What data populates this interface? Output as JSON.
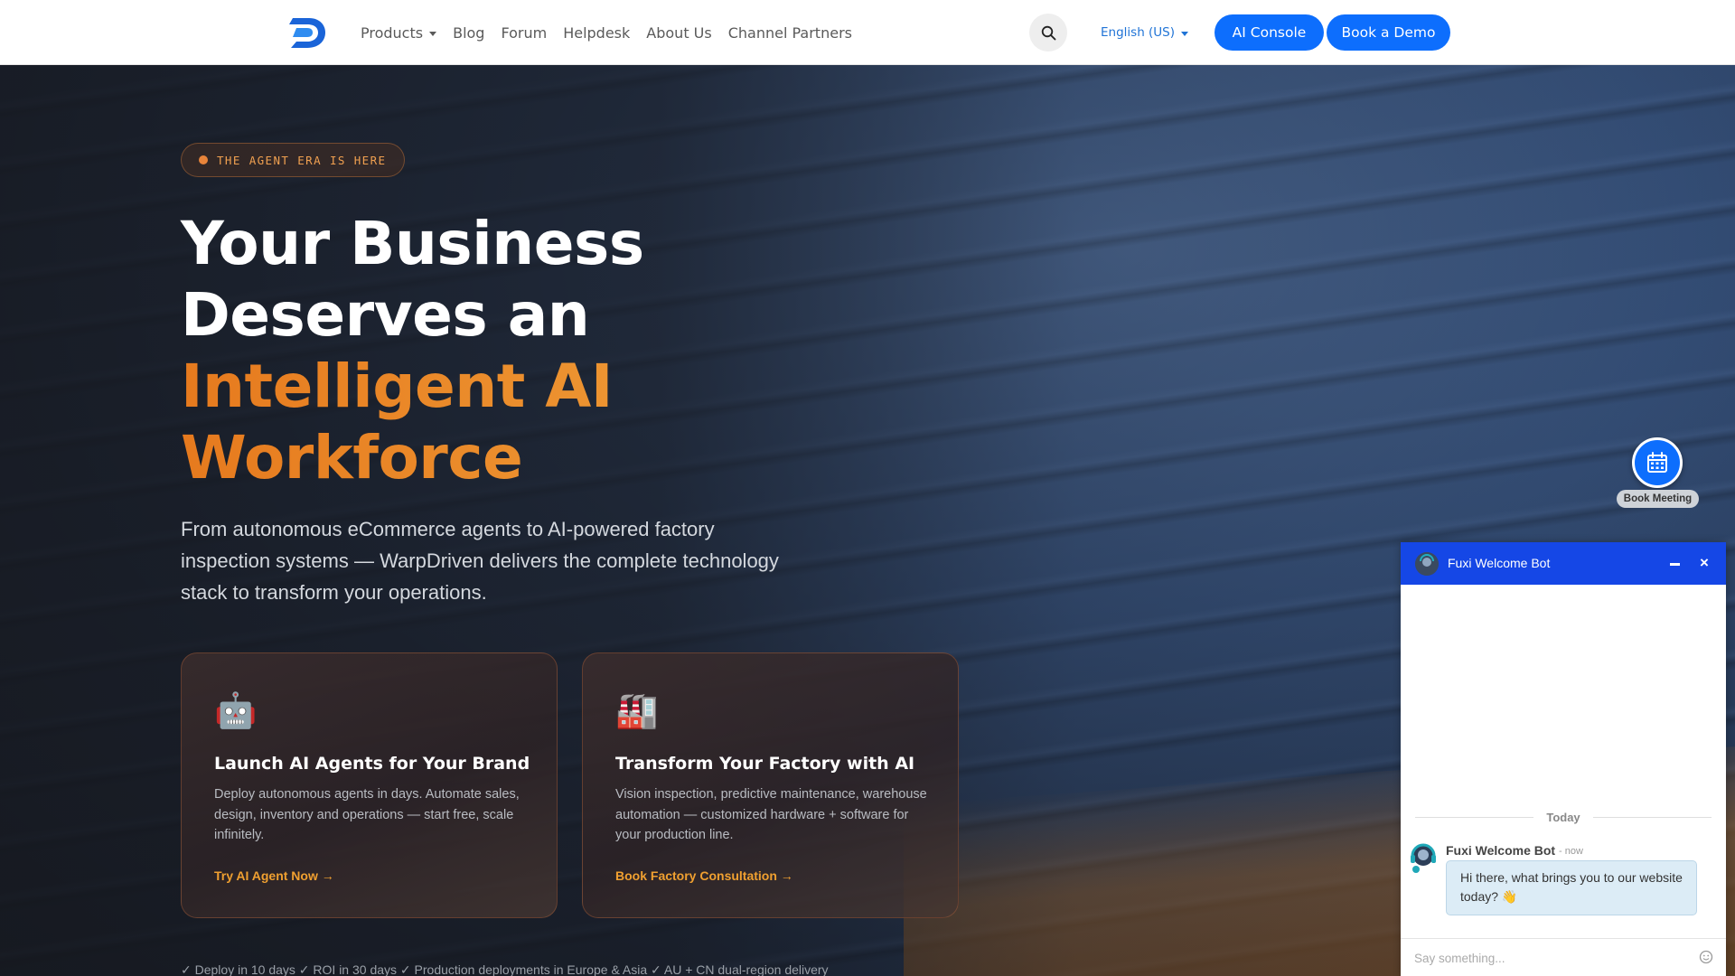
{
  "nav": {
    "links": [
      "Products",
      "Blog",
      "Forum",
      "Helpdesk",
      "About Us",
      "Channel Partners"
    ],
    "language": "English (US)",
    "console_label": "AI Console",
    "demo_label": "Book a Demo"
  },
  "hero": {
    "badge": "THE AGENT ERA IS HERE",
    "headline_white_1": "Your Business",
    "headline_white_2": "Deserves an",
    "headline_orange_1": "Intelligent AI",
    "headline_orange_2": "Workforce",
    "subtitle": "From autonomous eCommerce agents to AI-powered factory inspection systems — WarpDriven delivers the complete technology stack to transform your operations.",
    "cards": [
      {
        "icon": "🤖",
        "title": "Launch AI Agents for Your Brand",
        "description": "Deploy autonomous agents in days. Automate sales, design, inventory and operations — start free, scale infinitely.",
        "link": "Try AI Agent Now →"
      },
      {
        "icon": "🏭",
        "title": "Transform Your Factory with AI",
        "description": "Vision inspection, predictive maintenance, warehouse automation — customized hardware + software for your production line.",
        "link": "Book Factory Consultation →"
      }
    ],
    "trust_line": "✓ Deploy in 10 days ✓ ROI in 30 days ✓ Production deployments in Europe & Asia ✓ AU + CN dual-region delivery"
  },
  "meeting": {
    "label": "Book Meeting"
  },
  "chat": {
    "title": "Fuxi Welcome Bot",
    "close_glyph": "×",
    "date_divider": "Today",
    "sender": "Fuxi Welcome Bot",
    "time": "- now",
    "message": "Hi there, what brings you to our website today? 👋",
    "input_placeholder": "Say something..."
  },
  "colors": {
    "primary": "#0d6efd",
    "accent_orange": "#e67a1e",
    "chat_header": "#1547e6",
    "link_blue": "#1f73d6"
  }
}
